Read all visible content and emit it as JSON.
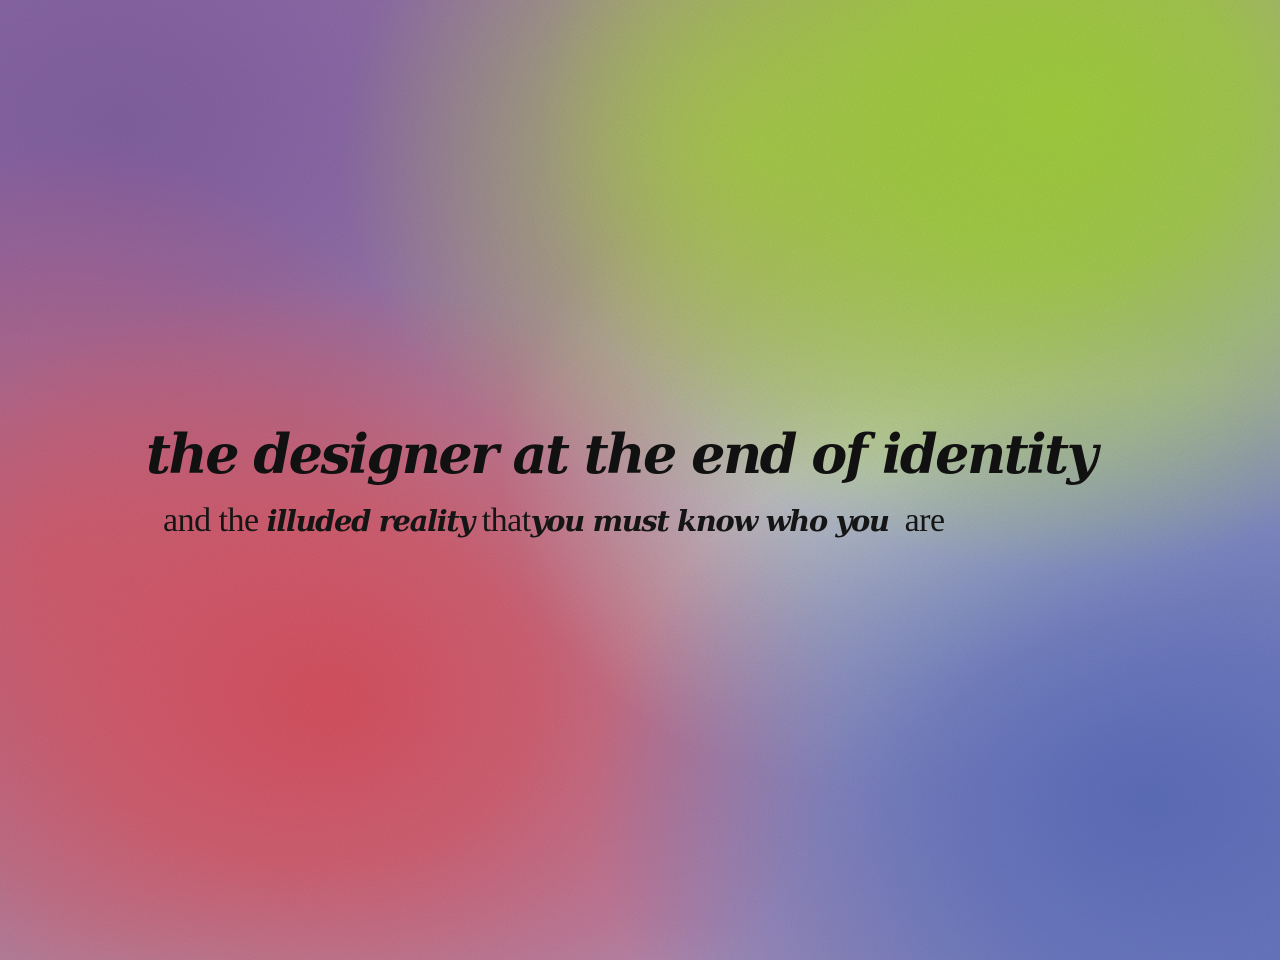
{
  "headline": {
    "title": "the designer at the end of identity"
  },
  "subheadline": {
    "segment_1": "and the",
    "segment_2": "illuded reality",
    "segment_3": "that",
    "segment_4": "you must know who you",
    "segment_5": "are"
  },
  "background": {
    "style": "grainy gradient",
    "colors": {
      "purple": "#8e6fa6",
      "lime": "#a0cd3c",
      "red": "#d6505f",
      "blue": "#5c6cb9",
      "pale": "#c8d7c8"
    }
  }
}
